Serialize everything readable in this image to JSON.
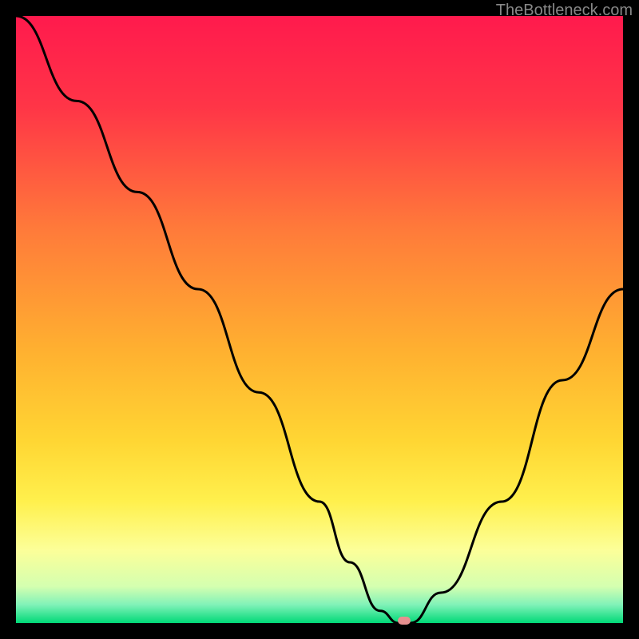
{
  "watermark": "TheBottleneck.com",
  "chart_data": {
    "type": "line",
    "title": "",
    "xlabel": "",
    "ylabel": "",
    "xlim": [
      0,
      100
    ],
    "ylim": [
      0,
      100
    ],
    "x": [
      0,
      10,
      20,
      30,
      40,
      50,
      55,
      60,
      63,
      65,
      70,
      80,
      90,
      100
    ],
    "values": [
      100,
      86,
      71,
      55,
      38,
      20,
      10,
      2,
      0,
      0,
      5,
      20,
      40,
      55
    ],
    "marker_x": 64,
    "marker_y": 0,
    "gradient_stops": [
      {
        "offset": 0,
        "color": "#ff1a4d"
      },
      {
        "offset": 15,
        "color": "#ff3547"
      },
      {
        "offset": 35,
        "color": "#ff7a3a"
      },
      {
        "offset": 55,
        "color": "#ffb030"
      },
      {
        "offset": 70,
        "color": "#ffd633"
      },
      {
        "offset": 80,
        "color": "#fff04d"
      },
      {
        "offset": 88,
        "color": "#fcff99"
      },
      {
        "offset": 94,
        "color": "#d4ffb0"
      },
      {
        "offset": 97,
        "color": "#80f2b8"
      },
      {
        "offset": 100,
        "color": "#00d977"
      }
    ]
  }
}
